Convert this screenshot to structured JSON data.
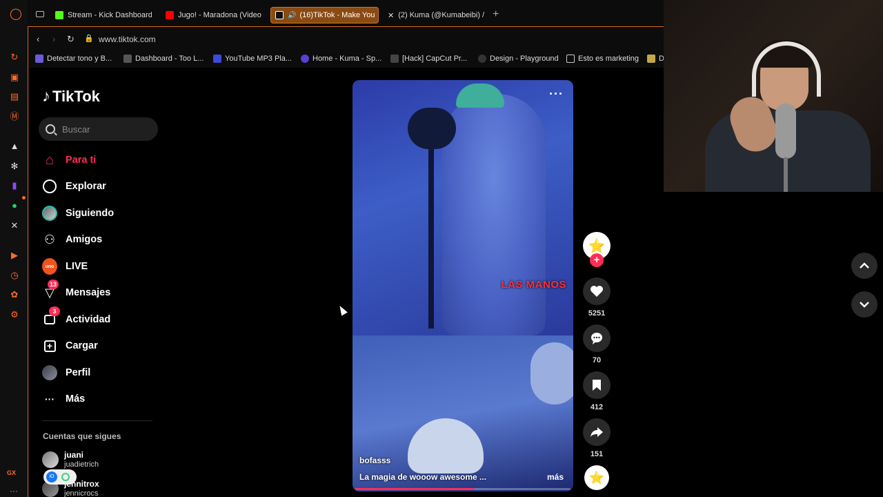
{
  "browser": {
    "tabs": [
      {
        "label": "Stream - Kick Dashboard",
        "color": "#53fc18"
      },
      {
        "label": "Jugo! - Maradona (Video",
        "color": "#ff0000"
      },
      {
        "label": "(16)TikTok - Make You",
        "color": "#000000",
        "active": true
      },
      {
        "label": "(2) Kuma (@Kumabeibi) /",
        "color": "#000000"
      }
    ],
    "url": "www.tiktok.com",
    "bookmarks": [
      "Detectar tono y B...",
      "Dashboard - Too L...",
      "YouTube MP3 Pla...",
      "Home - Kuma - Sp...",
      "[Hack] CapCut Pr...",
      "Design - Playground",
      "Esto es marketing",
      "D"
    ],
    "rail_label": "GX"
  },
  "tiktok": {
    "brand": "TikTok",
    "search_placeholder": "Buscar",
    "nav": [
      {
        "label": "Para ti",
        "icon": "home-icon"
      },
      {
        "label": "Explorar",
        "icon": "compass-icon"
      },
      {
        "label": "Siguiendo",
        "icon": "avatar-icon"
      },
      {
        "label": "Amigos",
        "icon": "friends-icon"
      },
      {
        "label": "LIVE",
        "icon": "live-icon"
      },
      {
        "label": "Mensajes",
        "icon": "send-icon",
        "badge": "13"
      },
      {
        "label": "Actividad",
        "icon": "inbox-icon",
        "badge": "3"
      },
      {
        "label": "Cargar",
        "icon": "upload-icon"
      },
      {
        "label": "Perfil",
        "icon": "profile-icon"
      },
      {
        "label": "Más",
        "icon": "more-icon"
      }
    ],
    "following_heading": "Cuentas que sigues",
    "accounts": [
      {
        "name": "juani",
        "handle": "juadietrich"
      },
      {
        "name": "jennitrox",
        "handle": "jennicrocs"
      }
    ],
    "live_icon_text": "uno",
    "floating_widget_text": "iO"
  },
  "video": {
    "author": "bofasss",
    "description": "La magia de wooow awesome ...",
    "more": "más",
    "overlay_text": "LAS MANOS",
    "progress": 0.55,
    "likes": "5251",
    "comments": "70",
    "saves": "412",
    "shares": "151"
  },
  "colors": {
    "accent": "#fe2c55",
    "opera": "#ff6a2a"
  }
}
